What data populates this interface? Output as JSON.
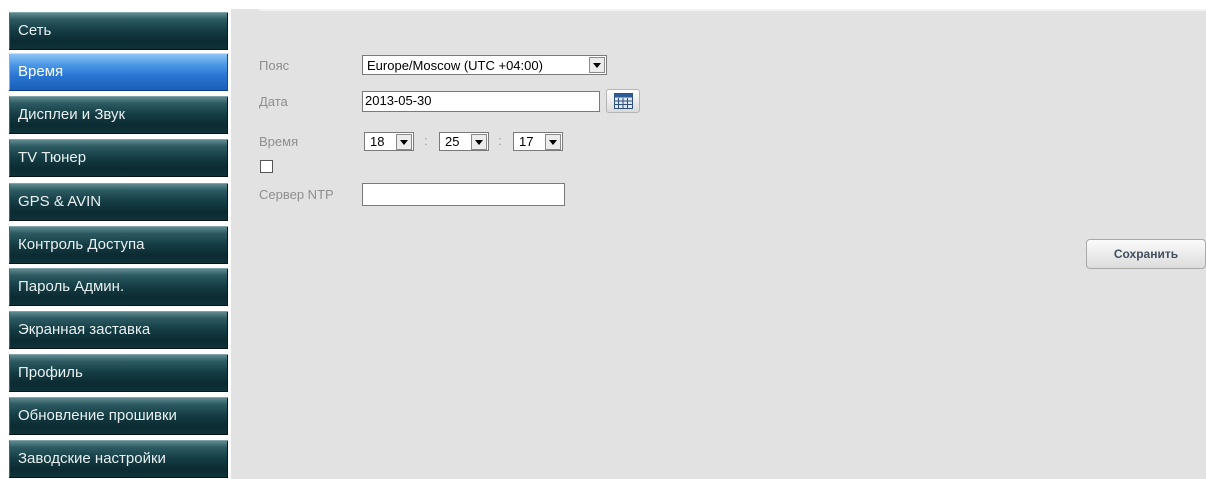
{
  "sidebar": {
    "items": [
      {
        "label": "Сеть",
        "active": false
      },
      {
        "label": "Время",
        "active": true
      },
      {
        "label": "Дисплеи и Звук",
        "active": false
      },
      {
        "label": "TV Тюнер",
        "active": false
      },
      {
        "label": "GPS & AVIN",
        "active": false
      },
      {
        "label": "Контроль Доступа",
        "active": false
      },
      {
        "label": "Пароль Админ.",
        "active": false
      },
      {
        "label": "Экранная заставка",
        "active": false
      },
      {
        "label": "Профиль",
        "active": false
      },
      {
        "label": "Обновление прошивки",
        "active": false
      },
      {
        "label": "Заводские настройки",
        "active": false
      }
    ]
  },
  "form": {
    "timezone": {
      "label": "Пояс",
      "value": "Europe/Moscow (UTC +04:00)"
    },
    "date": {
      "label": "Дата",
      "value": "2013-05-30",
      "calendar_icon": "calendar-icon"
    },
    "time": {
      "label": "Время",
      "hour": "18",
      "minute": "25",
      "second": "17",
      "separator": ":"
    },
    "ntp_enabled": false,
    "ntp_server": {
      "label": "Сервер NTP",
      "value": ""
    },
    "save_label": "Сохранить"
  },
  "colors": {
    "nav_dark": "#153d45",
    "nav_active": "#2a76d3",
    "panel_bg": "#e2e2e2",
    "label_gray": "#8e8e8e"
  }
}
